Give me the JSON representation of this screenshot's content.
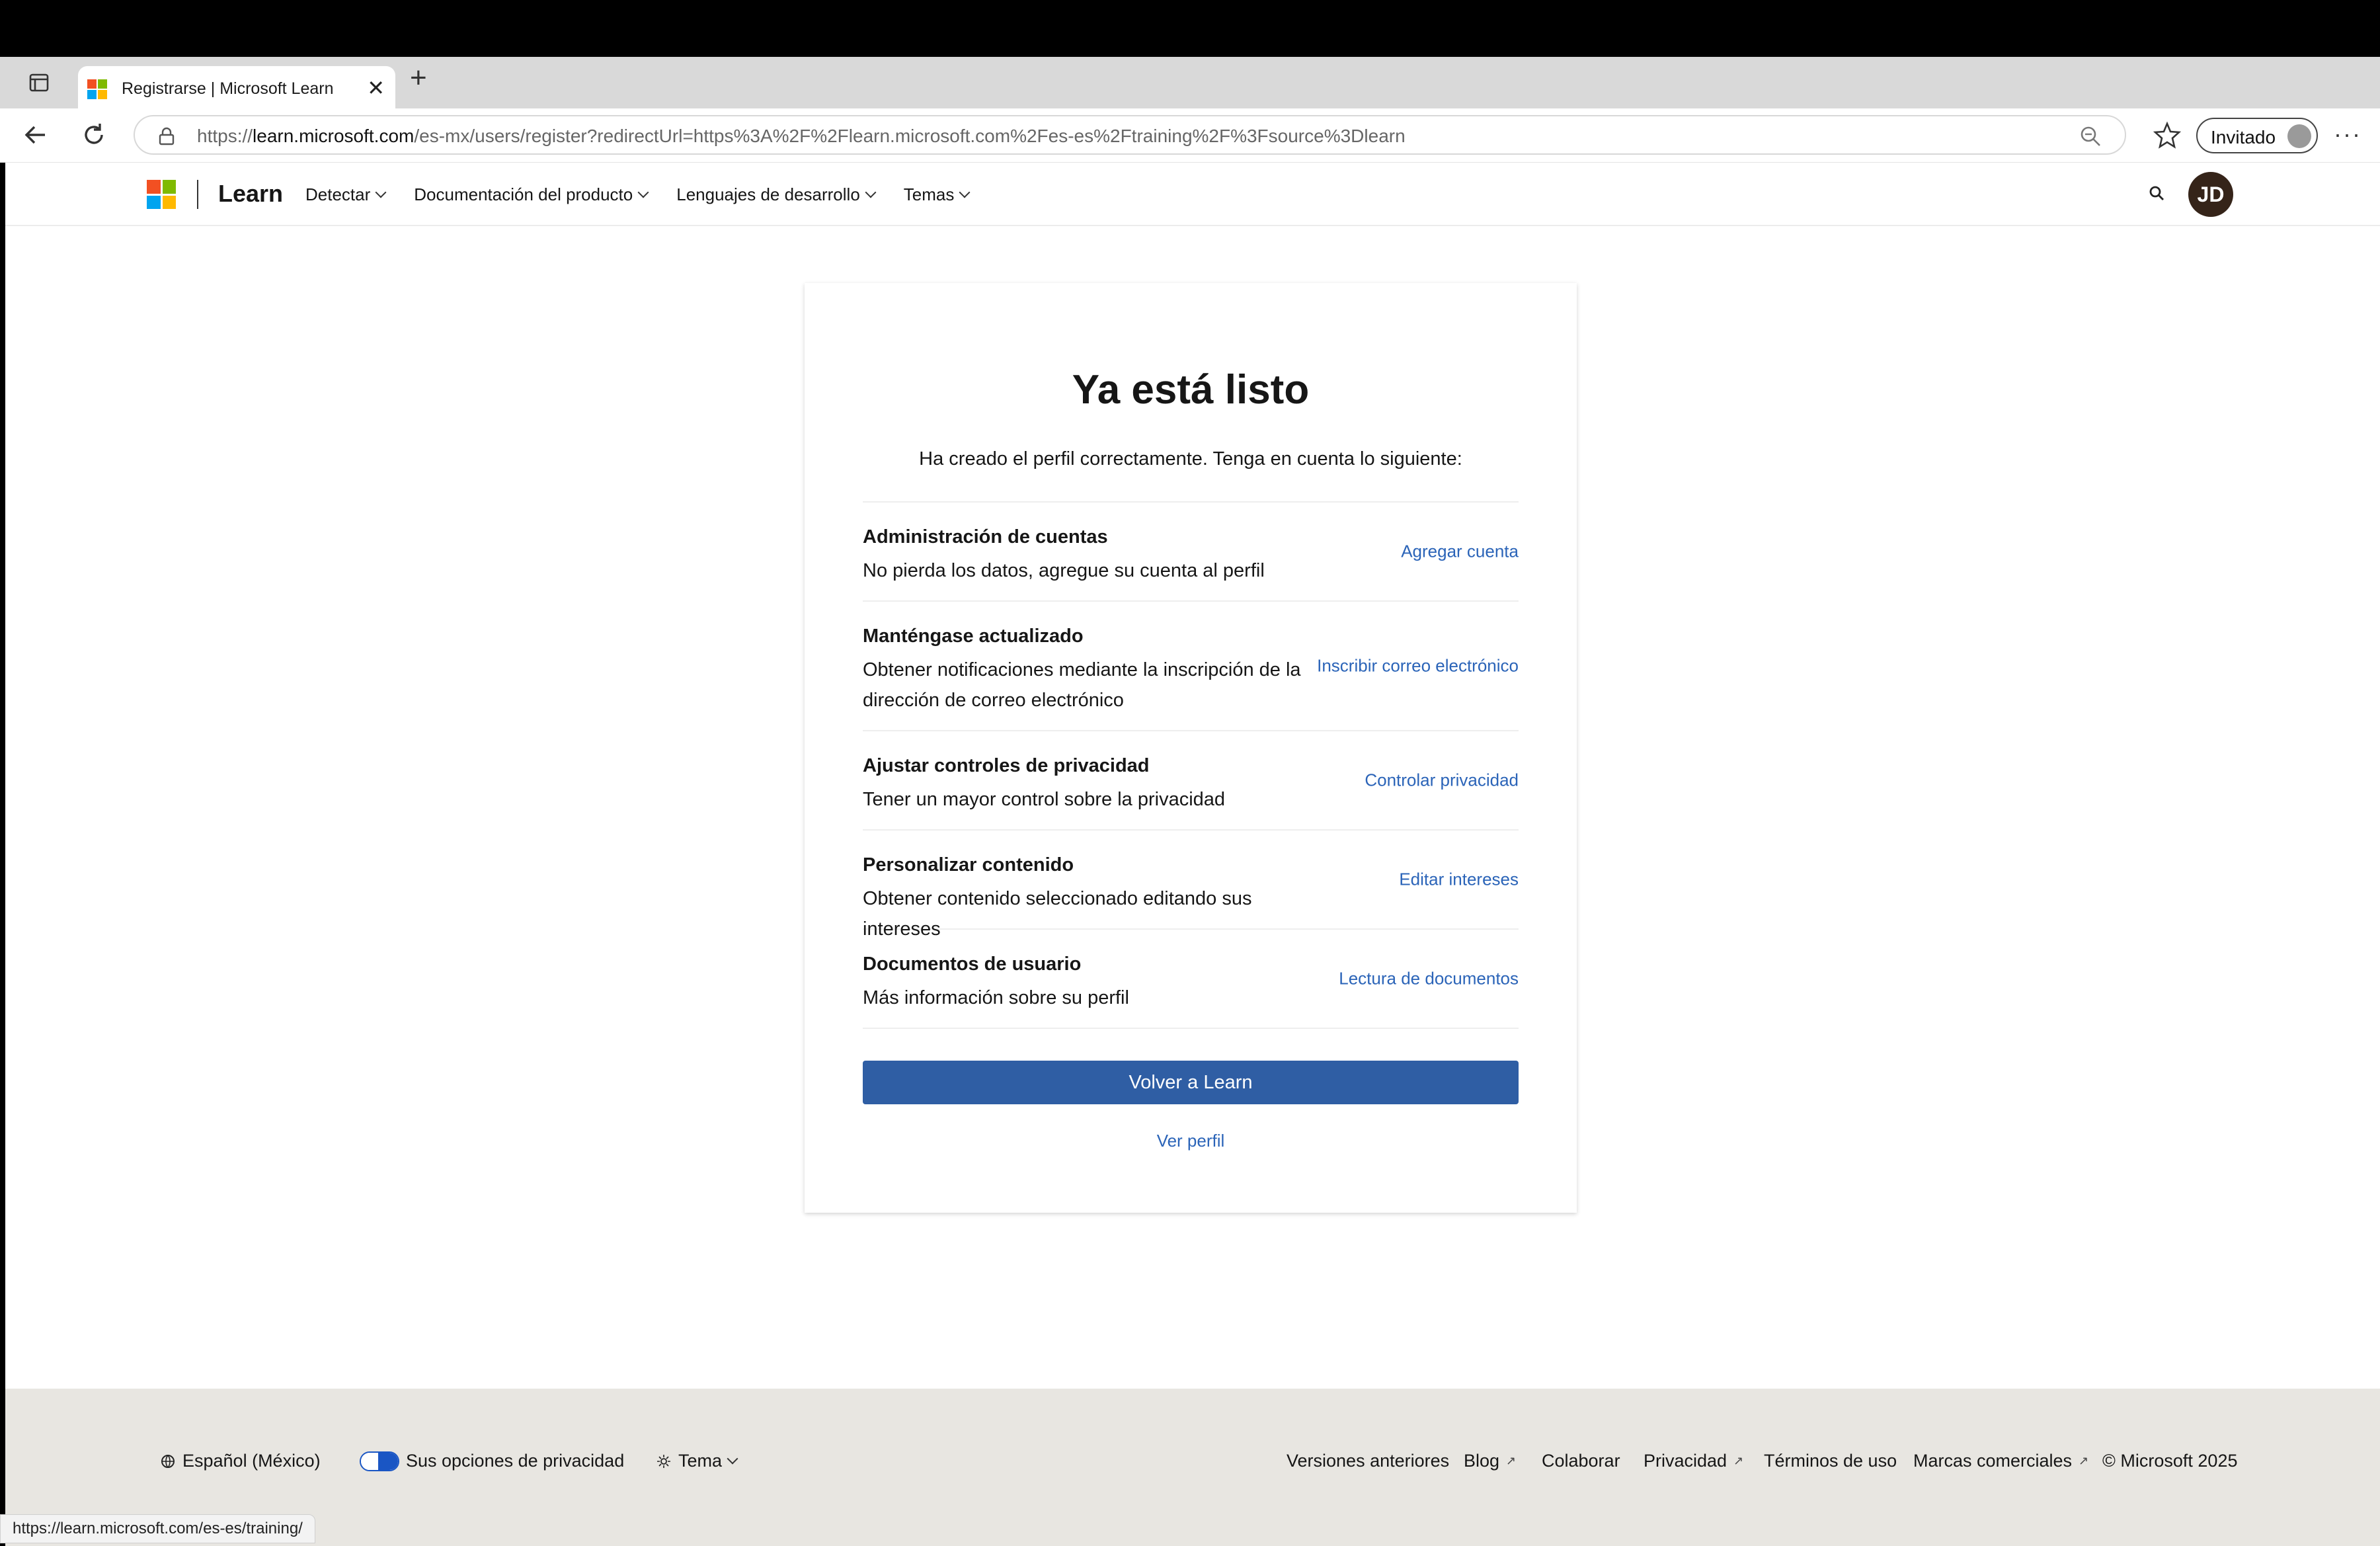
{
  "browser": {
    "tab_title": "Registrarse | Microsoft Learn",
    "new_tab": "+",
    "close_tab": "✕",
    "url_prefix": "https://",
    "url_domain": "learn.microsoft.com",
    "url_rest": "/es-mx/users/register?redirectUrl=https%3A%2F%2Flearn.microsoft.com%2Fes-es%2Ftraining%2F%3Fsource%3Dlearn",
    "profile_label": "Invitado",
    "more": "···",
    "status_url": "https://learn.microsoft.com/es-es/training/"
  },
  "header": {
    "brand": "Learn",
    "nav": [
      {
        "label": "Detectar"
      },
      {
        "label": "Documentación del producto"
      },
      {
        "label": "Lenguajes de desarrollo"
      },
      {
        "label": "Temas"
      }
    ],
    "avatar_initials": "JD"
  },
  "card": {
    "title": "Ya está listo",
    "subtitle": "Ha creado el perfil correctamente. Tenga en cuenta lo siguiente:",
    "rows": [
      {
        "title": "Administración de cuentas",
        "desc": "No pierda los datos, agregue su cuenta al perfil",
        "link": "Agregar cuenta"
      },
      {
        "title": "Manténgase actualizado",
        "desc": "Obtener notificaciones mediante la inscripción de la dirección de correo electrónico",
        "link": "Inscribir correo electrónico"
      },
      {
        "title": "Ajustar controles de privacidad",
        "desc": "Tener un mayor control sobre la privacidad",
        "link": "Controlar privacidad"
      },
      {
        "title": "Personalizar contenido",
        "desc": "Obtener contenido seleccionado editando sus intereses",
        "link": "Editar intereses"
      },
      {
        "title": "Documentos de usuario",
        "desc": "Más información sobre su perfil",
        "link": "Lectura de documentos"
      }
    ],
    "primary_button": "Volver a Learn",
    "secondary_link": "Ver perfil"
  },
  "footer": {
    "language": "Español (México)",
    "privacy_choices": "Sus opciones de privacidad",
    "theme": "Tema",
    "links": [
      "Versiones anteriores",
      "Blog",
      "Colaborar",
      "Privacidad",
      "Términos de uso",
      "Marcas comerciales"
    ],
    "copyright": "© Microsoft 2025"
  },
  "colors": {
    "accent": "#2f5ea4",
    "link": "#2b64b8",
    "footer_bg": "#e8e6e1",
    "ms_red": "#f25022",
    "ms_green": "#7fba00",
    "ms_blue": "#00a4ef",
    "ms_yellow": "#ffb900"
  }
}
